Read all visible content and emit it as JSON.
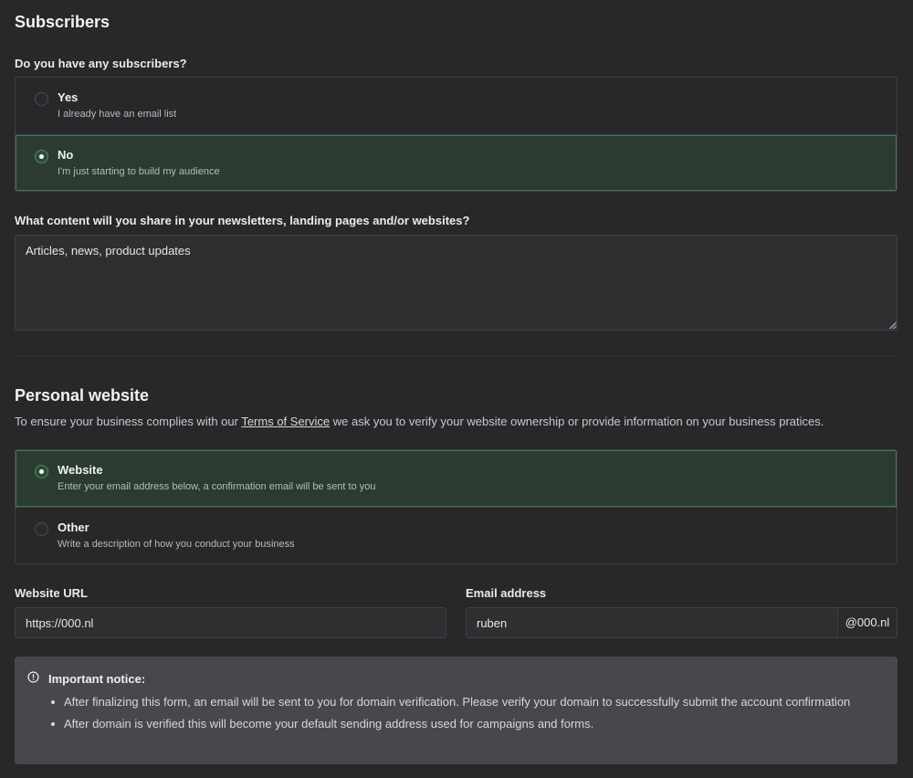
{
  "subscribers": {
    "title": "Subscribers",
    "question": "Do you have any subscribers?",
    "options": [
      {
        "title": "Yes",
        "desc": "I already have an email list",
        "selected": false
      },
      {
        "title": "No",
        "desc": "I'm just starting to build my audience",
        "selected": true
      }
    ]
  },
  "content": {
    "question": "What content will you share in your newsletters, landing pages and/or websites?",
    "value": "Articles, news, product updates"
  },
  "website": {
    "title": "Personal website",
    "intro_before": "To ensure your business complies with our ",
    "intro_link": "Terms of Service",
    "intro_after": " we ask you to verify your website ownership or provide information on your business pratices.",
    "options": [
      {
        "title": "Website",
        "desc": "Enter your email address below, a confirmation email will be sent to you",
        "selected": true
      },
      {
        "title": "Other",
        "desc": "Write a description of how you conduct your business",
        "selected": false
      }
    ],
    "url_label": "Website URL",
    "url_value": "https://000.nl",
    "email_label": "Email address",
    "email_value": "ruben",
    "email_suffix": "@000.nl"
  },
  "notice": {
    "icon": "info-circle-icon",
    "title": "Important notice:",
    "items": [
      "After finalizing this form, an email will be sent to you for domain verification. Please verify your domain to successfully submit the account confirmation",
      "After domain is verified this will become your default sending address used for campaigns and forms."
    ]
  },
  "colors": {
    "background": "#28282b",
    "selected_bg": "#2b3b31",
    "selected_border": "#3f7a55",
    "notice_bg": "#48484c"
  }
}
